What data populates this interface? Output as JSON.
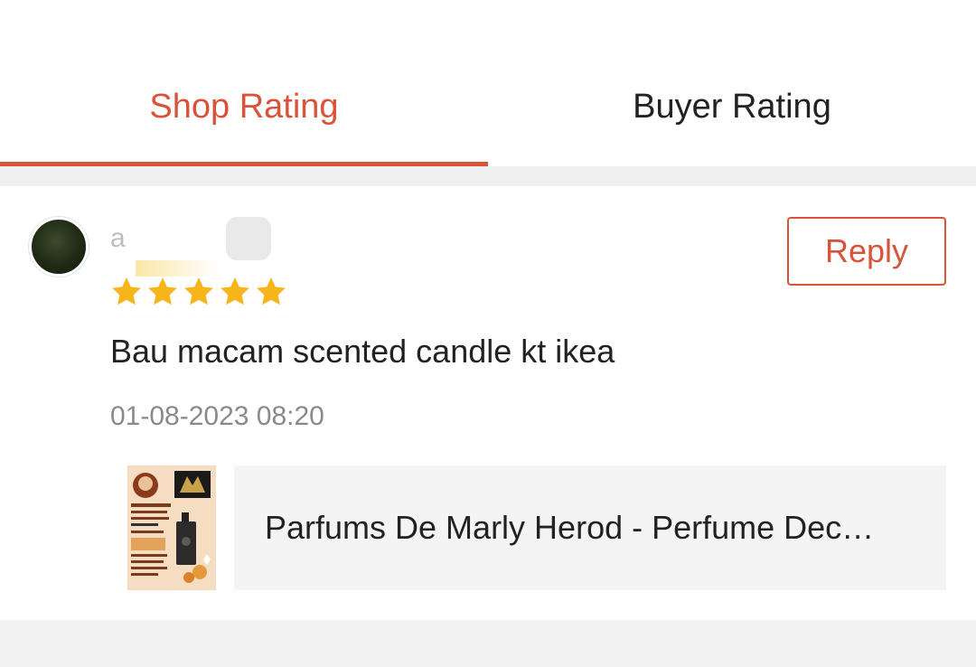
{
  "tabs": [
    {
      "label": "Shop Rating",
      "active": true
    },
    {
      "label": "Buyer Rating",
      "active": false
    }
  ],
  "colors": {
    "accent": "#d9533a",
    "star": "#f7b51d",
    "text": "#222222",
    "muted": "#8a8a8a",
    "band": "#f0f0f0"
  },
  "review": {
    "username": "a",
    "rating": 5,
    "max_rating": 5,
    "reply_label": "Reply",
    "comment": "Bau macam scented candle kt ikea",
    "timestamp": "01-08-2023 08:20",
    "product": {
      "title": "Parfums De Marly Herod - Perfume Dec…",
      "thumb_icon": "perfume-product-thumbnail"
    }
  }
}
